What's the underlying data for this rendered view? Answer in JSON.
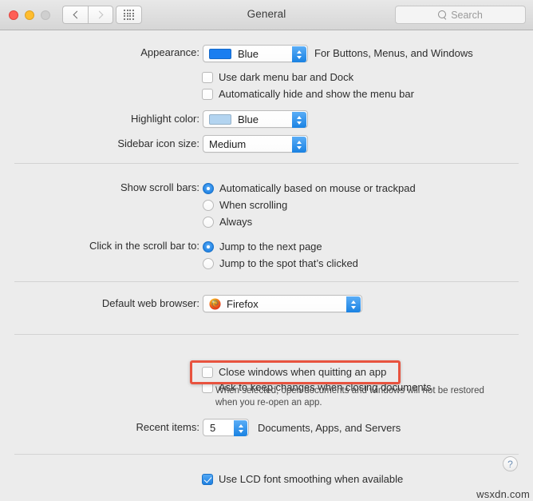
{
  "titlebar": {
    "title": "General",
    "search_placeholder": "Search",
    "back_icon": "chevron-left-icon",
    "forward_icon": "chevron-right-icon",
    "grid_icon": "grid-apps-icon",
    "search_icon": "search-icon"
  },
  "appearance": {
    "label": "Appearance:",
    "value": "Blue",
    "swatch_color": "#1a7ef0",
    "note": "For Buttons, Menus, and Windows",
    "checkboxes": [
      {
        "label": "Use dark menu bar and Dock",
        "checked": false
      },
      {
        "label": "Automatically hide and show the menu bar",
        "checked": false
      }
    ]
  },
  "highlight": {
    "label": "Highlight color:",
    "value": "Blue",
    "swatch_color": "#b3d4f0"
  },
  "sidebar_icon": {
    "label": "Sidebar icon size:",
    "value": "Medium"
  },
  "scroll_bars": {
    "label": "Show scroll bars:",
    "options": [
      {
        "label": "Automatically based on mouse or trackpad",
        "selected": true
      },
      {
        "label": "When scrolling",
        "selected": false
      },
      {
        "label": "Always",
        "selected": false
      }
    ]
  },
  "scroll_click": {
    "label": "Click in the scroll bar to:",
    "options": [
      {
        "label": "Jump to the next page",
        "selected": true
      },
      {
        "label": "Jump to the spot that’s clicked",
        "selected": false
      }
    ]
  },
  "browser": {
    "label": "Default web browser:",
    "value": "Firefox",
    "icon": "firefox-icon"
  },
  "documents": {
    "ask_keep_changes": {
      "label": "Ask to keep changes when closing documents",
      "checked": false
    },
    "close_windows": {
      "label": "Close windows when quitting an app",
      "checked": false
    },
    "hint_line1": "When selected, open documents and windows will not be restored",
    "hint_line2": "when you re-open an app.",
    "highlight_color": "#e8533f"
  },
  "recent_items": {
    "label": "Recent items:",
    "value": "5",
    "note": "Documents, Apps, and Servers"
  },
  "font_smoothing": {
    "label": "Use LCD font smoothing when available",
    "checked": true
  },
  "help": {
    "glyph": "?"
  },
  "watermark": {
    "text": "wsxdn.com"
  }
}
